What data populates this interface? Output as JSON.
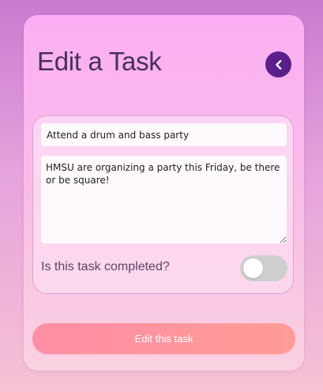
{
  "page": {
    "title": "Edit a Task"
  },
  "back_button": {
    "icon": "chevron-left-icon",
    "color": "#5b1f8c"
  },
  "form": {
    "task_name": {
      "value": "Attend a drum and bass party"
    },
    "task_description": {
      "value": "HMSU are organizing a party this Friday, be there or be square!"
    },
    "completed": {
      "label": "Is this task completed?",
      "checked": false
    },
    "submit_label": "Edit this task"
  },
  "colors": {
    "accent": "#5b1f8c",
    "submit_gradient_start": "#ff8ea6",
    "submit_gradient_end": "#ff9c95",
    "title_text": "#4a2e5c"
  }
}
